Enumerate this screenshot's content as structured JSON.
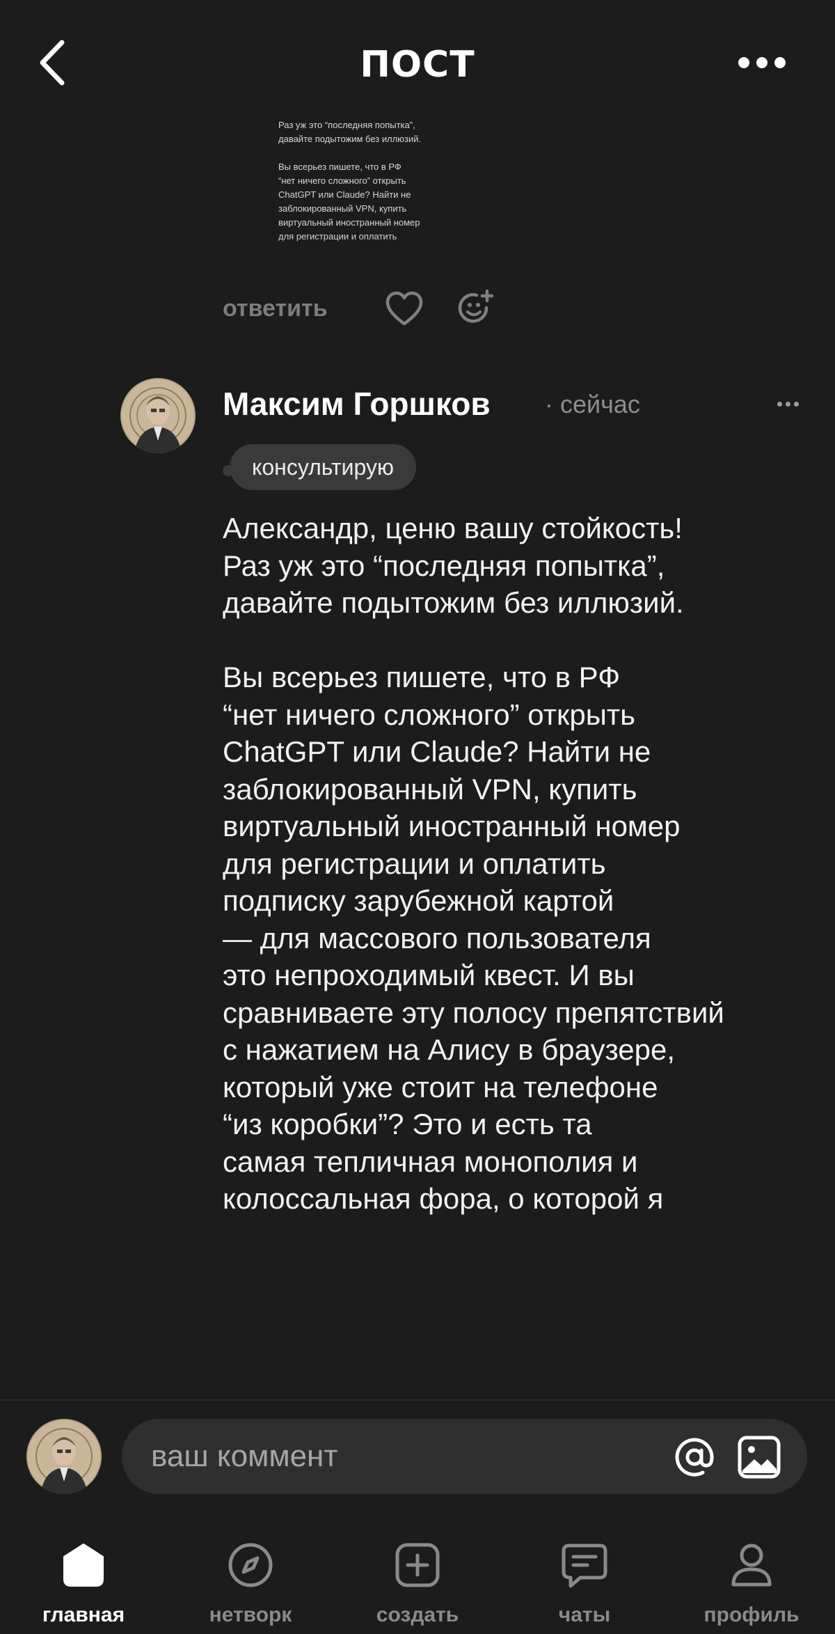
{
  "header": {
    "title": "ПОСТ",
    "back_icon": "chevron-left-icon",
    "more_icon": "more-dots-icon"
  },
  "quoted_preview": {
    "text": "Раз уж это “последняя попытка”,\nдавайте подытожим без иллюзий.\n\nВы всерьез пишете, что в РФ\n“нет ничего сложного” открыть\nChatGPT или Claude? Найти не\nзаблокированный VPN, купить\nвиртуальный иностранный номер\nдля регистрации и оплатить"
  },
  "actions": {
    "reply_label": "ответить",
    "like_icon": "heart-icon",
    "react_icon": "add-reaction-icon"
  },
  "comment": {
    "author": "Максим Горшков",
    "meta": "· сейчас",
    "badge": "консультирую",
    "paragraphs": [
      "Александр, ценю вашу стойкость!\nРаз уж это “последняя попытка”,\nдавайте подытожим без иллюзий.",
      "Вы всерьез пишете, что в РФ\n“нет ничего сложного” открыть\nChatGPT или Claude? Найти не\nзаблокированный VPN, купить\nвиртуальный иностранный номер\nдля регистрации и оплатить\nподписку зарубежной картой\n— для массового пользователя\nэто непроходимый квест. И вы\nсравниваете эту полосу препятствий\nс нажатием на Алису в браузере,\nкоторый уже стоит на телефоне\n“из коробки”? Это и есть та\nсамая тепличная монополия и\nколоссальная фора, о которой я"
    ]
  },
  "composer": {
    "placeholder": "ваш коммент",
    "mention_icon": "at-icon",
    "image_icon": "image-icon"
  },
  "nav": {
    "items": [
      {
        "label": "главная",
        "icon": "home-icon",
        "active": true
      },
      {
        "label": "нетворк",
        "icon": "compass-icon",
        "active": false
      },
      {
        "label": "создать",
        "icon": "plus-square-icon",
        "active": false
      },
      {
        "label": "чаты",
        "icon": "chat-icon",
        "active": false
      },
      {
        "label": "профиль",
        "icon": "profile-icon",
        "active": false
      }
    ]
  },
  "colors": {
    "background": "#1c1c1c",
    "text": "#ffffff",
    "muted": "#8a8a8a",
    "badge_bg": "#3a3a3a",
    "input_bg": "#2f2f2f"
  }
}
